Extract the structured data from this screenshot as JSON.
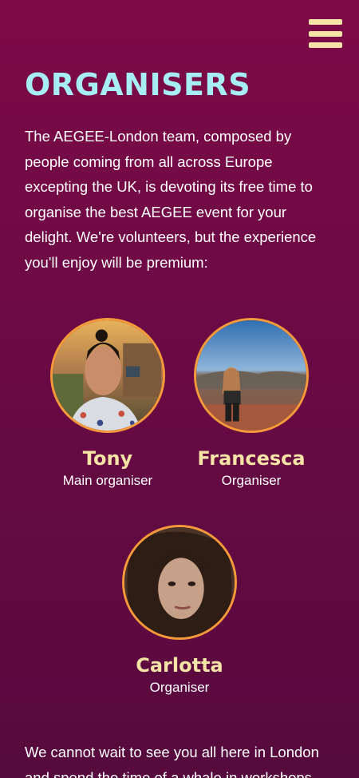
{
  "header": {
    "menu_icon": "hamburger-menu-icon"
  },
  "section": {
    "title": "ORGANISERS",
    "intro": "The AEGEE-London team, composed by people coming from all across Europe excepting the UK, is devoting its free time to organise the best AEGEE event for your delight. We're volunteers, but the experience you'll enjoy will be premium:",
    "members": [
      {
        "name": "Tony",
        "role": "Main organiser"
      },
      {
        "name": "Francesca",
        "role": "Organiser"
      },
      {
        "name": "Carlotta",
        "role": "Organiser"
      }
    ],
    "outro_line1": "We cannot wait to see you all here in London",
    "outro_line2": "and spend the time of a whale in workshops"
  },
  "colors": {
    "background": "#7d0a47",
    "title": "#a6eef3",
    "accent": "#f6e3a6",
    "avatar_border": "#f59a3a"
  }
}
